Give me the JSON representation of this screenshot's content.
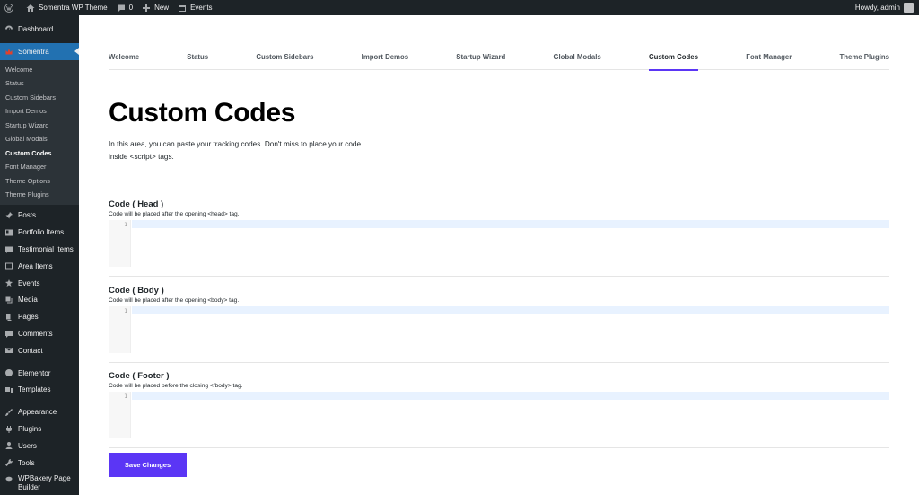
{
  "adminbar": {
    "site_name": "Somentra WP Theme",
    "comments_count": "0",
    "new_label": "New",
    "events_label": "Events",
    "howdy": "Howdy, admin"
  },
  "sidebar": {
    "dashboard": "Dashboard",
    "theme_menu": "Somentra",
    "submenu": [
      "Welcome",
      "Status",
      "Custom Sidebars",
      "Import Demos",
      "Startup Wizard",
      "Global Modals",
      "Custom Codes",
      "Font Manager",
      "Theme Options",
      "Theme Plugins"
    ],
    "items": [
      "Posts",
      "Portfolio Items",
      "Testimonial Items",
      "Area Items",
      "Events",
      "Media",
      "Pages",
      "Comments",
      "Contact"
    ],
    "items2": [
      "Elementor",
      "Templates"
    ],
    "items3": [
      "Appearance",
      "Plugins",
      "Users",
      "Tools",
      "WPBakery Page Builder"
    ]
  },
  "tabs": [
    "Welcome",
    "Status",
    "Custom Sidebars",
    "Import Demos",
    "Startup Wizard",
    "Global Modals",
    "Custom Codes",
    "Font Manager",
    "Theme Plugins"
  ],
  "page": {
    "title": "Custom Codes",
    "intro": "In this area, you can paste your tracking codes. Don't miss to place your code inside <script> tags."
  },
  "sections": [
    {
      "label": "Code ( Head )",
      "desc": "Code will be placed after the opening <head> tag.",
      "line": "1"
    },
    {
      "label": "Code ( Body )",
      "desc": "Code will be placed after the opening <body> tag.",
      "line": "1"
    },
    {
      "label": "Code ( Footer )",
      "desc": "Code will be placed before the closing </body> tag.",
      "line": "1"
    }
  ],
  "save_label": "Save Changes",
  "colors": {
    "accent": "#5b36f5",
    "admin_dark": "#1d2327",
    "wp_blue": "#2271b1"
  }
}
